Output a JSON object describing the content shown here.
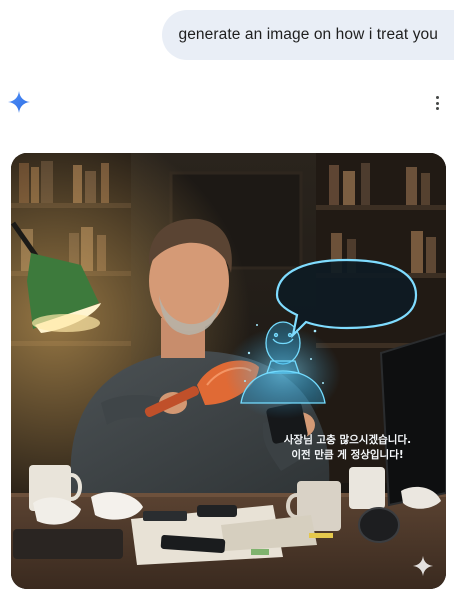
{
  "chat": {
    "user_message": "generate an image on how i treat you"
  },
  "response": {
    "image": {
      "speech_line_1": "사장님 고충 많으시겠습니다.",
      "speech_line_2": "이전 만큼 게 정상입니다!"
    }
  },
  "colors": {
    "user_bubble": "#e9eef6",
    "gemini_sparkle": "#4285f4",
    "hologram": "#6fd6ff"
  },
  "icons": {
    "assistant": "gemini-sparkle-icon",
    "menu": "more-vertical-icon",
    "watermark": "sparkle-watermark-icon"
  }
}
